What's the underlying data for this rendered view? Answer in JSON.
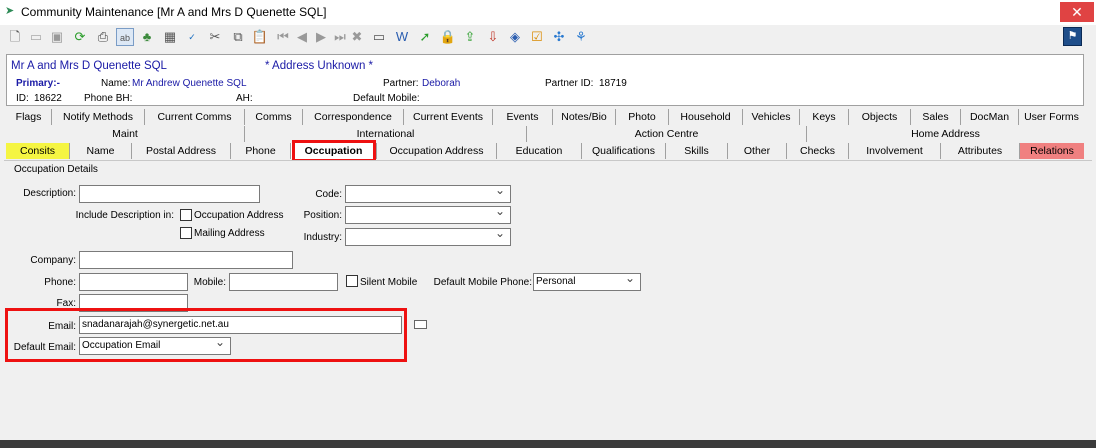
{
  "window": {
    "title": "Community Maintenance  [Mr A and Mrs D Quenette SQL]",
    "close_glyph": "✕",
    "flag_glyph": "⚑"
  },
  "toolbar": {
    "icons": [
      "new-icon",
      "open-icon",
      "save-icon",
      "refresh-icon",
      "print-icon",
      "spellcheck-icon",
      "tree-icon",
      "calculator-icon",
      "abc-check-icon",
      "cut-icon",
      "copy-icon",
      "paste-icon",
      "first-icon",
      "prev-icon",
      "next-icon",
      "last-icon",
      "delete-icon",
      "card-icon",
      "word-icon",
      "arrow-icon",
      "lock-icon",
      "export-icon",
      "import-icon",
      "tag-icon",
      "clipboard-icon",
      "network-icon",
      "split-icon"
    ]
  },
  "header": {
    "name": "Mr A and Mrs D Quenette SQL",
    "address_status": "* Address Unknown *",
    "primary_label": "Primary:-",
    "name_label": "Name:",
    "name_value": "Mr Andrew Quenette SQL",
    "partner_label": "Partner:",
    "partner_value": "Deborah",
    "partner_id_label": "Partner ID:",
    "partner_id_value": "18719",
    "id_label": "ID:",
    "id_value": "18622",
    "phone_bh_label": "Phone BH:",
    "ah_label": "AH:",
    "default_mobile_label": "Default Mobile:"
  },
  "tabs": {
    "row1": [
      "Flags",
      "Notify Methods",
      "Current Comms",
      "Comms",
      "Correspondence",
      "Current Events",
      "Events",
      "Notes/Bio",
      "Photo",
      "Household",
      "Vehicles",
      "Keys",
      "Objects",
      "Sales",
      "DocMan",
      "User Forms"
    ],
    "row2": [
      "Maint",
      "International",
      "Action Centre",
      "Home Address"
    ],
    "row3": [
      "Consits",
      "Name",
      "Postal Address",
      "Phone",
      "Occupation",
      "Occupation Address",
      "Education",
      "Qualifications",
      "Skills",
      "Other",
      "Checks",
      "Involvement",
      "Attributes",
      "Relations"
    ]
  },
  "form": {
    "group_title": "Occupation Details",
    "description_label": "Description:",
    "description_value": "",
    "include_label": "Include Description in:",
    "occupation_address_label": "Occupation Address",
    "mailing_address_label": "Mailing Address",
    "code_label": "Code:",
    "position_label": "Position:",
    "industry_label": "Industry:",
    "company_label": "Company:",
    "phone_label": "Phone:",
    "mobile_label": "Mobile:",
    "silent_mobile_label": "Silent Mobile",
    "default_mobile_phone_label": "Default Mobile Phone:",
    "default_mobile_phone_value": "Personal",
    "fax_label": "Fax:",
    "email_label": "Email:",
    "email_value": "snadanarajah@synergetic.net.au",
    "default_email_label": "Default Email:",
    "default_email_value": "Occupation Email"
  },
  "colors": {
    "consits_tab": "#f5f542",
    "relations_tab": "#f08080",
    "highlight": "#e11111"
  }
}
